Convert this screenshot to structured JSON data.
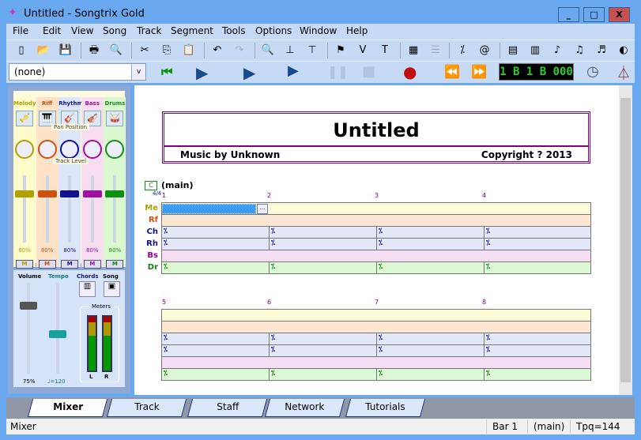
{
  "window": {
    "title": "Untitled - Songtrix Gold",
    "minimize": "_",
    "maximize": "□",
    "close": "X"
  },
  "menu": [
    "File",
    "Edit",
    "View",
    "Song",
    "Track",
    "Segment",
    "Tools",
    "Options",
    "Window",
    "Help"
  ],
  "toolbar1": [
    {
      "name": "new-icon",
      "glyph": "▯"
    },
    {
      "name": "open-icon",
      "glyph": "📂"
    },
    {
      "name": "save-icon",
      "glyph": "💾"
    },
    {
      "name": "print-icon",
      "glyph": "🖶"
    },
    {
      "name": "print-preview-icon",
      "glyph": "🔍"
    },
    {
      "name": "cut-icon",
      "glyph": "✂"
    },
    {
      "name": "copy-icon",
      "glyph": "⎘"
    },
    {
      "name": "paste-icon",
      "glyph": "📋"
    },
    {
      "name": "undo-icon",
      "glyph": "↶"
    },
    {
      "name": "redo-icon",
      "glyph": "↷"
    },
    {
      "name": "song-properties-icon",
      "glyph": "🔍"
    },
    {
      "name": "split-icon",
      "glyph": "⊥"
    },
    {
      "name": "join-icon",
      "glyph": "⊤"
    },
    {
      "name": "marker-flag-icon",
      "glyph": "⚑"
    },
    {
      "name": "velocity-icon",
      "glyph": "V"
    },
    {
      "name": "transpose-icon",
      "glyph": "T"
    },
    {
      "name": "grid-icon",
      "glyph": "▦"
    },
    {
      "name": "list-icon",
      "glyph": "☰"
    },
    {
      "name": "repeat-icon",
      "glyph": "⁒"
    },
    {
      "name": "at-icon",
      "glyph": "@"
    },
    {
      "name": "track-view-icon",
      "glyph": "▤"
    },
    {
      "name": "keyboard-icon",
      "glyph": "▥"
    },
    {
      "name": "notes-icon",
      "glyph": "♪"
    },
    {
      "name": "notes-alt-icon",
      "glyph": "♫"
    },
    {
      "name": "drum-notes-icon",
      "glyph": "♬"
    },
    {
      "name": "network-icon",
      "glyph": "◐"
    }
  ],
  "transport": {
    "style_select": "(none)",
    "counter": "1 B 1 B 000"
  },
  "mixer": {
    "tracks": [
      {
        "name": "Melody",
        "color": "#b0a000",
        "bg": "#fffccc",
        "level": "80%",
        "mute": "M",
        "icon": "trumpet-icon",
        "glyph": "🎺"
      },
      {
        "name": "Riff",
        "color": "#d05010",
        "bg": "#fde2c8",
        "level": "80%",
        "mute": "M",
        "icon": "piano-icon",
        "glyph": "🎹"
      },
      {
        "name": "Rhythm",
        "color": "#101090",
        "bg": "#dde6f8",
        "level": "80%",
        "mute": "M",
        "icon": "guitar-icon",
        "glyph": "🎸"
      },
      {
        "name": "Bass",
        "color": "#a010a0",
        "bg": "#f8dcf0",
        "level": "80%",
        "mute": "M",
        "icon": "bass-icon",
        "glyph": "🎻"
      },
      {
        "name": "Drums",
        "color": "#109010",
        "bg": "#dcf8d0",
        "level": "80%",
        "mute": "M",
        "icon": "drum-icon",
        "glyph": "🥁"
      }
    ],
    "pan_label": "Pan Position",
    "level_label": "Track Level",
    "pan_l": "L",
    "pan_r": "R",
    "volume_label": "Volume",
    "volume_value": "75%",
    "tempo_label": "Tempo",
    "tempo_value": "♩=120",
    "chords_label": "Chords",
    "song_label": "Song",
    "meters_label": "Meters",
    "meter_l": "L",
    "meter_r": "R"
  },
  "song": {
    "title": "Untitled",
    "music_by": "Music by Unknown",
    "copyright": "Copyright ? 2013",
    "segment": "(main)",
    "segment_key": "C",
    "time_sig": "4/4",
    "tracks": [
      {
        "abbr": "Me",
        "color": "#b0a000",
        "bg": "#fcfcd8",
        "repeat": false
      },
      {
        "abbr": "Rf",
        "color": "#d05010",
        "bg": "#fde6d2",
        "repeat": false
      },
      {
        "abbr": "Ch",
        "color": "#101090",
        "bg": "#e2e8f8",
        "repeat": true
      },
      {
        "abbr": "Rh",
        "color": "#101090",
        "bg": "#e2e8f8",
        "repeat": true
      },
      {
        "abbr": "Bs",
        "color": "#900090",
        "bg": "#f6def2",
        "repeat": false
      },
      {
        "abbr": "Dr",
        "color": "#108010",
        "bg": "#ddf8d4",
        "repeat": true
      }
    ],
    "bars_row1": [
      "1",
      "2",
      "3",
      "4"
    ],
    "bars_row2": [
      "5",
      "6",
      "7",
      "8"
    ],
    "repeat_glyph": "⁒",
    "more": "..."
  },
  "tabs": [
    "Mixer",
    "Track",
    "Staff",
    "Network",
    "Tutorials"
  ],
  "active_tab": "Mixer",
  "status": {
    "message": "Mixer",
    "bar": "Bar 1",
    "segment": "(main)",
    "tpq": "Tpq=144"
  }
}
